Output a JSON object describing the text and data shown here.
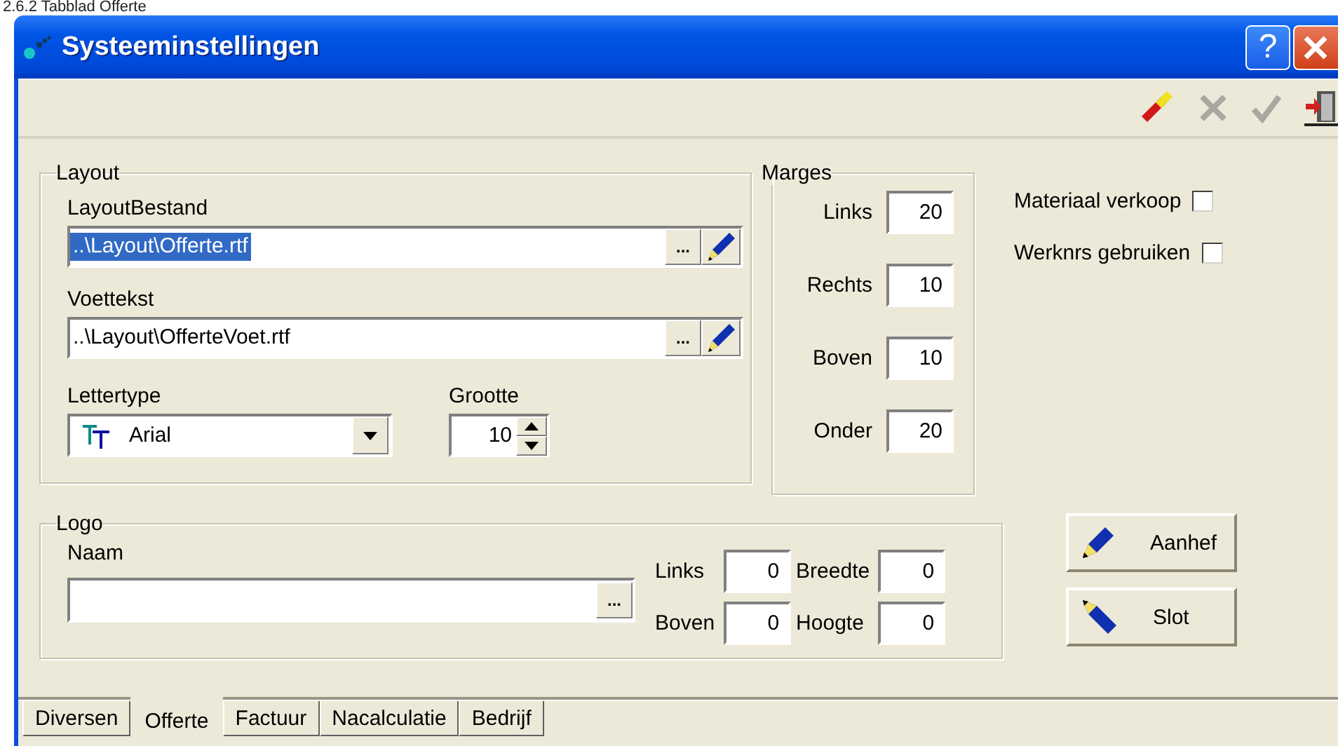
{
  "doc_heading": "2.6.2     Tabblad Offerte",
  "window": {
    "title": "Systeeminstellingen",
    "help": "?"
  },
  "toolbar": [
    {
      "kind": "eraser",
      "disabled": false
    },
    {
      "kind": "cancel",
      "disabled": true
    },
    {
      "kind": "confirm",
      "disabled": true
    },
    {
      "kind": "exit",
      "disabled": false
    }
  ],
  "layout_group": {
    "legend": "Layout",
    "files": [
      {
        "label": "LayoutBestand",
        "value": "..\\Layout\\Offerte.rtf",
        "selected": true,
        "browse": "..."
      },
      {
        "label": "Voettekst",
        "value": "..\\Layout\\OfferteVoet.rtf",
        "selected": false,
        "browse": "..."
      }
    ],
    "font": {
      "label": "Lettertype",
      "value": "Arial"
    },
    "size": {
      "label": "Grootte",
      "value": "10"
    }
  },
  "margins": {
    "legend": "Marges",
    "fields": [
      {
        "label": "Links",
        "value": "20"
      },
      {
        "label": "Rechts",
        "value": "10"
      },
      {
        "label": "Boven",
        "value": "10"
      },
      {
        "label": "Onder",
        "value": "20"
      }
    ]
  },
  "options": [
    {
      "label": "Materiaal verkoop",
      "checked": false
    },
    {
      "label": "Werknrs gebruiken",
      "checked": false
    }
  ],
  "logo": {
    "legend": "Logo",
    "name": {
      "label": "Naam",
      "browse": "..."
    },
    "fields": [
      {
        "label": "Links",
        "value": "0"
      },
      {
        "label": "Breedte",
        "value": "0"
      },
      {
        "label": "Boven",
        "value": "0"
      },
      {
        "label": "Hoogte",
        "value": "0"
      }
    ]
  },
  "buttons": [
    {
      "kind": "pen",
      "label": "Aanhef"
    },
    {
      "kind": "pen-down",
      "label": "Slot"
    }
  ],
  "tabs": [
    {
      "label": "Diversen",
      "selected": false
    },
    {
      "label": "Offerte",
      "selected": true
    },
    {
      "label": "Factuur",
      "selected": false
    },
    {
      "label": "Nacalculatie",
      "selected": false
    },
    {
      "label": "Bedrijf",
      "selected": false
    }
  ]
}
